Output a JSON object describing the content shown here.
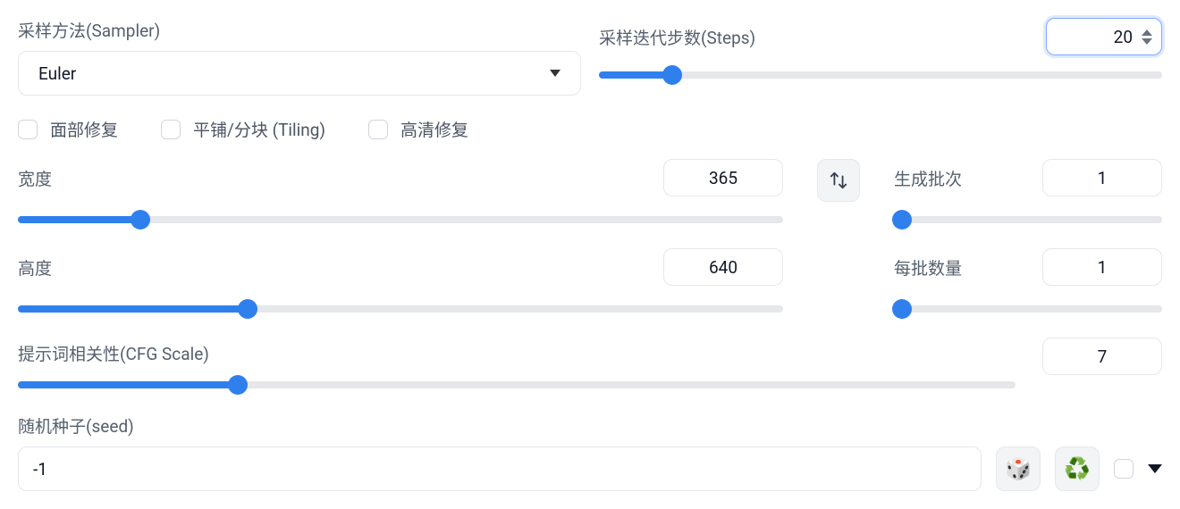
{
  "sampler": {
    "label": "采样方法(Sampler)",
    "value": "Euler"
  },
  "steps": {
    "label": "采样迭代步数(Steps)",
    "value": "20",
    "slider_percent": 13
  },
  "checkboxes": {
    "face_restore": "面部修复",
    "tiling": "平铺/分块 (Tiling)",
    "hires_fix": "高清修复"
  },
  "width": {
    "label": "宽度",
    "value": "365",
    "slider_percent": 16
  },
  "height": {
    "label": "高度",
    "value": "640",
    "slider_percent": 30
  },
  "batch_count": {
    "label": "生成批次",
    "value": "1",
    "slider_percent": 3
  },
  "batch_size": {
    "label": "每批数量",
    "value": "1",
    "slider_percent": 3
  },
  "cfg": {
    "label": "提示词相关性(CFG Scale)",
    "value": "7",
    "slider_percent": 22
  },
  "seed": {
    "label": "随机种子(seed)",
    "value": "-1"
  }
}
